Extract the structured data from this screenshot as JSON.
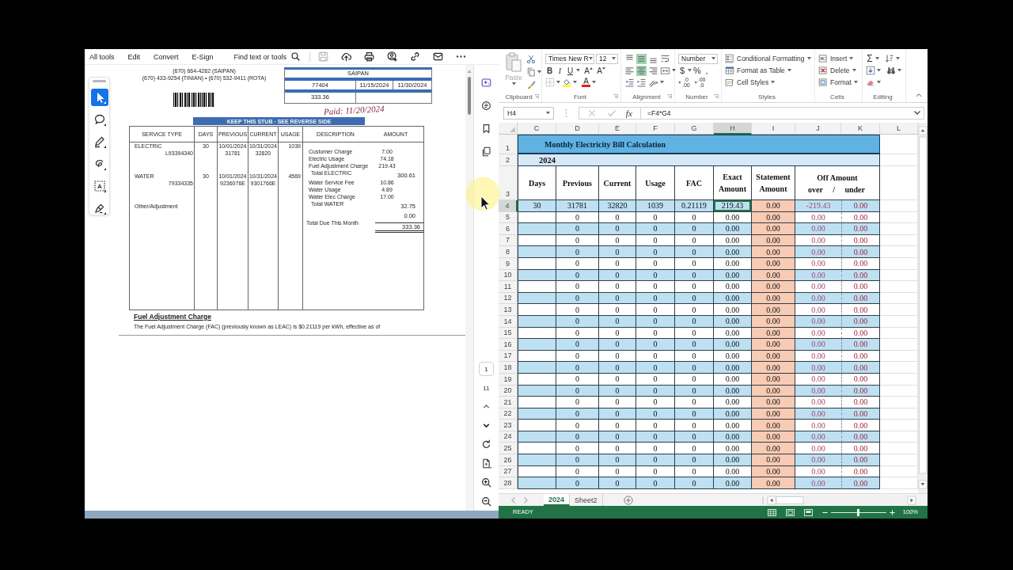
{
  "pdf_viewer": {
    "menu": [
      "All tools",
      "Edit",
      "Convert",
      "E-Sign"
    ],
    "search_label": "Find text or tools",
    "save_disabled": true,
    "tools": [
      {
        "kind": "select",
        "selected": true
      },
      {
        "kind": "comment",
        "selected": false
      },
      {
        "kind": "pen",
        "selected": false
      },
      {
        "kind": "draw",
        "selected": false
      },
      {
        "kind": "text",
        "glyph": "A",
        "selected": false
      },
      {
        "kind": "sign",
        "selected": false
      }
    ],
    "page_number": "1",
    "page_count": "11"
  },
  "document": {
    "phone_lines": [
      "(670) 664-4282 (SAIPAN)",
      "(670) 433-9254 (TINIAN) • (670) 532-9411 (ROTA)"
    ],
    "stub": {
      "location": "SAIPAN",
      "account_number": "77404",
      "due_date": "11/15/2024",
      "past_due_date": "11/30/2024",
      "amount_due": "333.36"
    },
    "paid_note": "Paid: 11/20/2024",
    "banner": "KEEP THIS STUB · SEE REVERSE SIDE",
    "columns": [
      "SERVICE TYPE",
      "DAYS",
      "PREVIOUS",
      "CURRENT",
      "USAGE",
      "DESCRIPTION",
      "AMOUNT"
    ],
    "services": [
      {
        "type": "ELECTRIC",
        "account": "L93394340",
        "days": "30",
        "previous_date": "10/01/2024",
        "previous_reading": "31781",
        "current_date": "10/31/2024",
        "current_reading": "32820",
        "usage": "1039"
      },
      {
        "type": "WATER",
        "account": "79334335",
        "days": "30",
        "previous_date": "10/01/2024",
        "previous_reading": "9236076E",
        "current_date": "10/31/2024",
        "current_reading": "9301766E",
        "usage": "4569"
      }
    ],
    "other_adjustment": "Other/Adjustment",
    "charges": [
      {
        "kind": "item",
        "description": "Customer Charge",
        "amount": "7.00"
      },
      {
        "kind": "item",
        "description": "Electric Usage",
        "amount": "74.18"
      },
      {
        "kind": "item",
        "description": "Fuel Adjustment Charge",
        "amount": "219.43"
      },
      {
        "kind": "total",
        "description": "Total ELECTRIC",
        "amount": "300.61"
      },
      {
        "kind": "item",
        "description": "Water Service Fee",
        "amount": "10.86"
      },
      {
        "kind": "item",
        "description": "Water Usage",
        "amount": "4.89"
      },
      {
        "kind": "item",
        "description": "Water Elec Charge",
        "amount": "17.00"
      },
      {
        "kind": "total",
        "description": "Total WATER",
        "amount": "32.75"
      },
      {
        "kind": "adjustment",
        "amount": "0.00"
      },
      {
        "kind": "grand_total",
        "description": "Total Due This Month",
        "amount": "333.36"
      }
    ],
    "fac_heading": "Fuel Adjustment Charge",
    "fac_text": "The Fuel Adjustment Charge (FAC) (previously known as LEAC) is $0.21119 per kWh, effective as of"
  },
  "spreadsheet": {
    "ribbon": {
      "clipboard": {
        "paste": {
          "label": "Paste",
          "disabled": true
        },
        "label": "Clipboard"
      },
      "font": {
        "name": "Times New R",
        "size": "12",
        "bold": "B",
        "italic": "I",
        "underline": "U",
        "grow": "A",
        "shrink": "A",
        "color_letter": "A",
        "label": "Font"
      },
      "alignment": {
        "vertical": [
          {
            "kind": "top",
            "selected": false
          },
          {
            "kind": "middle",
            "selected": true
          },
          {
            "kind": "bottom",
            "selected": false
          }
        ],
        "horizontal": [
          {
            "kind": "left",
            "selected": false
          },
          {
            "kind": "center",
            "selected": true
          },
          {
            "kind": "right",
            "selected": false
          }
        ],
        "label": "Alignment"
      },
      "number": {
        "format": "Number",
        "currency": "$",
        "percent": "%",
        "comma": ",",
        "increase_decimal": [
          ".0",
          ".00"
        ],
        "decrease_decimal": [
          ".00",
          ".0"
        ],
        "label": "Number"
      },
      "styles": {
        "items": [
          {
            "kind": "conditional",
            "label": "Conditional Formatting"
          },
          {
            "kind": "table",
            "label": "Format as Table"
          },
          {
            "kind": "cell",
            "label": "Cell Styles"
          }
        ],
        "label": "Styles"
      },
      "cells": {
        "items": [
          {
            "kind": "insert",
            "label": "Insert"
          },
          {
            "kind": "delete",
            "label": "Delete"
          },
          {
            "kind": "format",
            "label": "Format"
          }
        ],
        "label": "Cells"
      },
      "editing": {
        "autosum": "Σ",
        "label": "Editing"
      }
    },
    "formula_bar": {
      "name_box": "H4",
      "function_label": "fx",
      "formula": "=F4*G4"
    },
    "columns": [
      {
        "label": "C",
        "selected": false
      },
      {
        "label": "D",
        "selected": false
      },
      {
        "label": "E",
        "selected": false
      },
      {
        "label": "F",
        "selected": false
      },
      {
        "label": "G",
        "selected": false
      },
      {
        "label": "H",
        "selected": true
      },
      {
        "label": "I",
        "selected": false
      },
      {
        "label": "J",
        "selected": false
      },
      {
        "label": "K",
        "selected": false
      },
      {
        "label": "L",
        "selected": false
      }
    ],
    "title_row": {
      "number": "1",
      "selected": false,
      "title": "Monthly Electricity Bill Calculation"
    },
    "year_row": {
      "number": "2",
      "selected": false,
      "year": "2024"
    },
    "header_row": {
      "number": "3",
      "selected": false,
      "headers": [
        "Days",
        "Previous",
        "Current",
        "Usage",
        "FAC",
        "Exact Amount",
        "Statement Amount"
      ],
      "off_amount": {
        "title": "Off Amount",
        "over": "over",
        "separator": "/",
        "under": "under"
      }
    },
    "rows": [
      {
        "number": "4",
        "selected": true,
        "days": "30",
        "previous": "31781",
        "current": "32820",
        "usage": "1039",
        "fac": "0.21119",
        "exact": "219.43",
        "statement": "0.00",
        "over": "-219.43",
        "under": "0.00"
      },
      {
        "number": "5",
        "selected": false,
        "previous": "0",
        "current": "0",
        "usage": "0",
        "fac": "0",
        "exact": "0.00",
        "statement": "0.00",
        "over": "0.00",
        "under": "0.00"
      },
      {
        "number": "6",
        "selected": false,
        "previous": "0",
        "current": "0",
        "usage": "0",
        "fac": "0",
        "exact": "0.00",
        "statement": "0.00",
        "over": "0.00",
        "under": "0.00"
      },
      {
        "number": "7",
        "selected": false,
        "previous": "0",
        "current": "0",
        "usage": "0",
        "fac": "0",
        "exact": "0.00",
        "statement": "0.00",
        "over": "0.00",
        "under": "0.00"
      },
      {
        "number": "8",
        "selected": false,
        "previous": "0",
        "current": "0",
        "usage": "0",
        "fac": "0",
        "exact": "0.00",
        "statement": "0.00",
        "over": "0.00",
        "under": "0.00"
      },
      {
        "number": "9",
        "selected": false,
        "previous": "0",
        "current": "0",
        "usage": "0",
        "fac": "0",
        "exact": "0.00",
        "statement": "0.00",
        "over": "0.00",
        "under": "0.00"
      },
      {
        "number": "10",
        "selected": false,
        "previous": "0",
        "current": "0",
        "usage": "0",
        "fac": "0",
        "exact": "0.00",
        "statement": "0.00",
        "over": "0.00",
        "under": "0.00"
      },
      {
        "number": "11",
        "selected": false,
        "previous": "0",
        "current": "0",
        "usage": "0",
        "fac": "0",
        "exact": "0.00",
        "statement": "0.00",
        "over": "0.00",
        "under": "0.00"
      },
      {
        "number": "12",
        "selected": false,
        "previous": "0",
        "current": "0",
        "usage": "0",
        "fac": "0",
        "exact": "0.00",
        "statement": "0.00",
        "over": "0.00",
        "under": "0.00"
      },
      {
        "number": "13",
        "selected": false,
        "previous": "0",
        "current": "0",
        "usage": "0",
        "fac": "0",
        "exact": "0.00",
        "statement": "0.00",
        "over": "0.00",
        "under": "0.00"
      },
      {
        "number": "14",
        "selected": false,
        "previous": "0",
        "current": "0",
        "usage": "0",
        "fac": "0",
        "exact": "0.00",
        "statement": "0.00",
        "over": "0.00",
        "under": "0.00"
      },
      {
        "number": "15",
        "selected": false,
        "previous": "0",
        "current": "0",
        "usage": "0",
        "fac": "0",
        "exact": "0.00",
        "statement": "0.00",
        "over": "0.00",
        "under": "0.00"
      },
      {
        "number": "16",
        "selected": false,
        "previous": "0",
        "current": "0",
        "usage": "0",
        "fac": "0",
        "exact": "0.00",
        "statement": "0.00",
        "over": "0.00",
        "under": "0.00"
      },
      {
        "number": "17",
        "selected": false,
        "previous": "0",
        "current": "0",
        "usage": "0",
        "fac": "0",
        "exact": "0.00",
        "statement": "0.00",
        "over": "0.00",
        "under": "0.00"
      },
      {
        "number": "18",
        "selected": false,
        "previous": "0",
        "current": "0",
        "usage": "0",
        "fac": "0",
        "exact": "0.00",
        "statement": "0.00",
        "over": "0.00",
        "under": "0.00"
      },
      {
        "number": "19",
        "selected": false,
        "previous": "0",
        "current": "0",
        "usage": "0",
        "fac": "0",
        "exact": "0.00",
        "statement": "0.00",
        "over": "0.00",
        "under": "0.00"
      },
      {
        "number": "20",
        "selected": false,
        "previous": "0",
        "current": "0",
        "usage": "0",
        "fac": "0",
        "exact": "0.00",
        "statement": "0.00",
        "over": "0.00",
        "under": "0.00"
      },
      {
        "number": "21",
        "selected": false,
        "previous": "0",
        "current": "0",
        "usage": "0",
        "fac": "0",
        "exact": "0.00",
        "statement": "0.00",
        "over": "0.00",
        "under": "0.00"
      },
      {
        "number": "22",
        "selected": false,
        "previous": "0",
        "current": "0",
        "usage": "0",
        "fac": "0",
        "exact": "0.00",
        "statement": "0.00",
        "over": "0.00",
        "under": "0.00"
      },
      {
        "number": "23",
        "selected": false,
        "previous": "0",
        "current": "0",
        "usage": "0",
        "fac": "0",
        "exact": "0.00",
        "statement": "0.00",
        "over": "0.00",
        "under": "0.00"
      },
      {
        "number": "24",
        "selected": false,
        "previous": "0",
        "current": "0",
        "usage": "0",
        "fac": "0",
        "exact": "0.00",
        "statement": "0.00",
        "over": "0.00",
        "under": "0.00"
      },
      {
        "number": "25",
        "selected": false,
        "previous": "0",
        "current": "0",
        "usage": "0",
        "fac": "0",
        "exact": "0.00",
        "statement": "0.00",
        "over": "0.00",
        "under": "0.00"
      },
      {
        "number": "26",
        "selected": false,
        "previous": "0",
        "current": "0",
        "usage": "0",
        "fac": "0",
        "exact": "0.00",
        "statement": "0.00",
        "over": "0.00",
        "under": "0.00"
      },
      {
        "number": "27",
        "selected": false,
        "previous": "0",
        "current": "0",
        "usage": "0",
        "fac": "0",
        "exact": "0.00",
        "statement": "0.00",
        "over": "0.00",
        "under": "0.00"
      },
      {
        "number": "28",
        "selected": false,
        "previous": "0",
        "current": "0",
        "usage": "0",
        "fac": "0",
        "exact": "0.00",
        "statement": "0.00",
        "over": "0.00",
        "under": "0.00"
      }
    ],
    "sheet_tabs": [
      {
        "label": "2024",
        "selected": true
      },
      {
        "label": "Sheet2",
        "selected": false
      }
    ],
    "status": {
      "mode": "READY",
      "zoom_slider": {
        "level": 0.5
      },
      "zoom_label": "100%"
    }
  }
}
